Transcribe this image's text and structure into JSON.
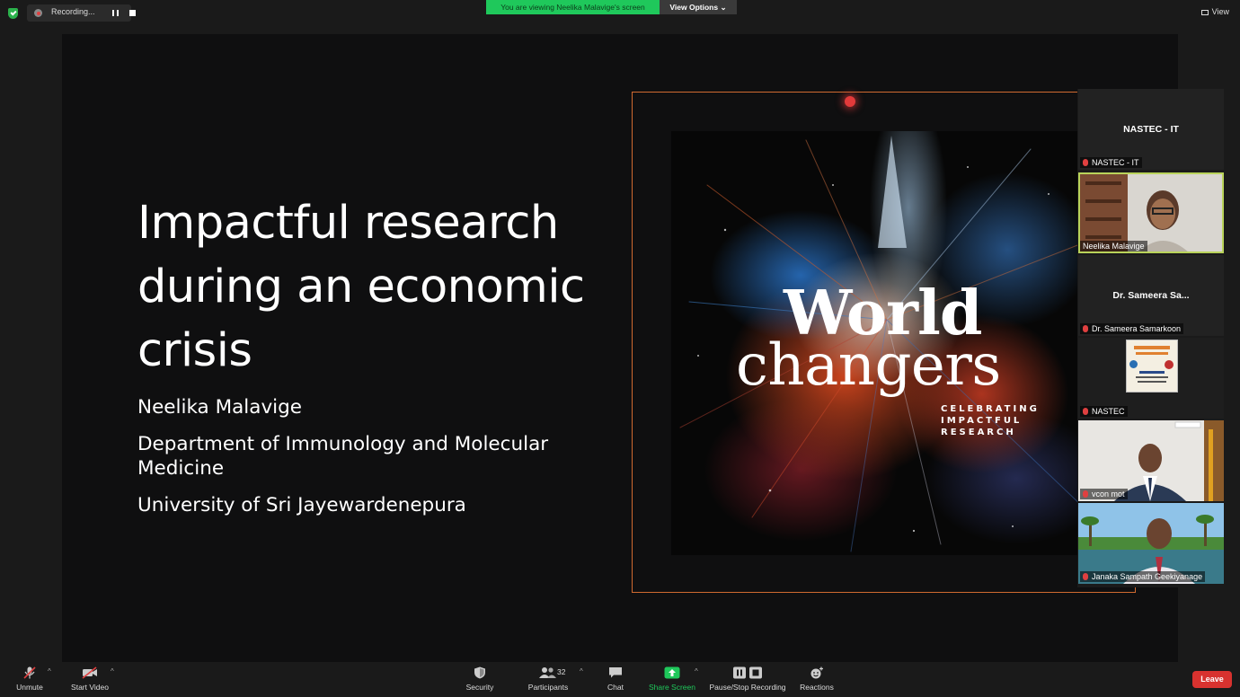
{
  "top_bar": {
    "recording_label": "Recording...",
    "viewing_banner": "You are viewing Neelika Malavige's screen",
    "view_options_label": "View Options",
    "view_label": "View"
  },
  "slide": {
    "title_lines": [
      "Impactful research",
      "during an economic",
      "crisis"
    ],
    "author": "Neelika Malavige",
    "department_lines": [
      "Department of Immunology and Molecular",
      "Medicine"
    ],
    "university": "University of Sri Jayewardenepura",
    "image": {
      "word1": "World",
      "word2": "changers",
      "subtitle_lines": [
        "CELEBRATING",
        "IMPACTFUL",
        "RESEARCH"
      ]
    }
  },
  "participants": [
    {
      "display_name": "NASTEC - IT",
      "label": "NASTEC - IT",
      "video": false,
      "muted": true
    },
    {
      "display_name": "",
      "label": "Neelika Malavige",
      "video": true,
      "muted": false,
      "active_speaker": true
    },
    {
      "display_name": "Dr. Sameera Sa...",
      "label": "Dr. Sameera Samarkoon",
      "video": false,
      "muted": true
    },
    {
      "display_name": "",
      "label": "NASTEC",
      "video": true,
      "muted": true
    },
    {
      "display_name": "",
      "label": "vcon mot",
      "video": true,
      "muted": true
    },
    {
      "display_name": "",
      "label": "Janaka Sampath Geekiyanage",
      "video": true,
      "muted": true
    }
  ],
  "toolbar": {
    "unmute_label": "Unmute",
    "start_video_label": "Start Video",
    "security_label": "Security",
    "participants_label": "Participants",
    "participants_count": "32",
    "chat_label": "Chat",
    "share_screen_label": "Share Screen",
    "recording_label": "Pause/Stop Recording",
    "reactions_label": "Reactions",
    "leave_label": "Leave"
  },
  "colors": {
    "banner_green": "#1fc85b",
    "share_green": "#1fc85b",
    "leave_red": "#d8322f",
    "frame_orange": "#d06a30",
    "active_speaker_border": "#b9d35a"
  }
}
